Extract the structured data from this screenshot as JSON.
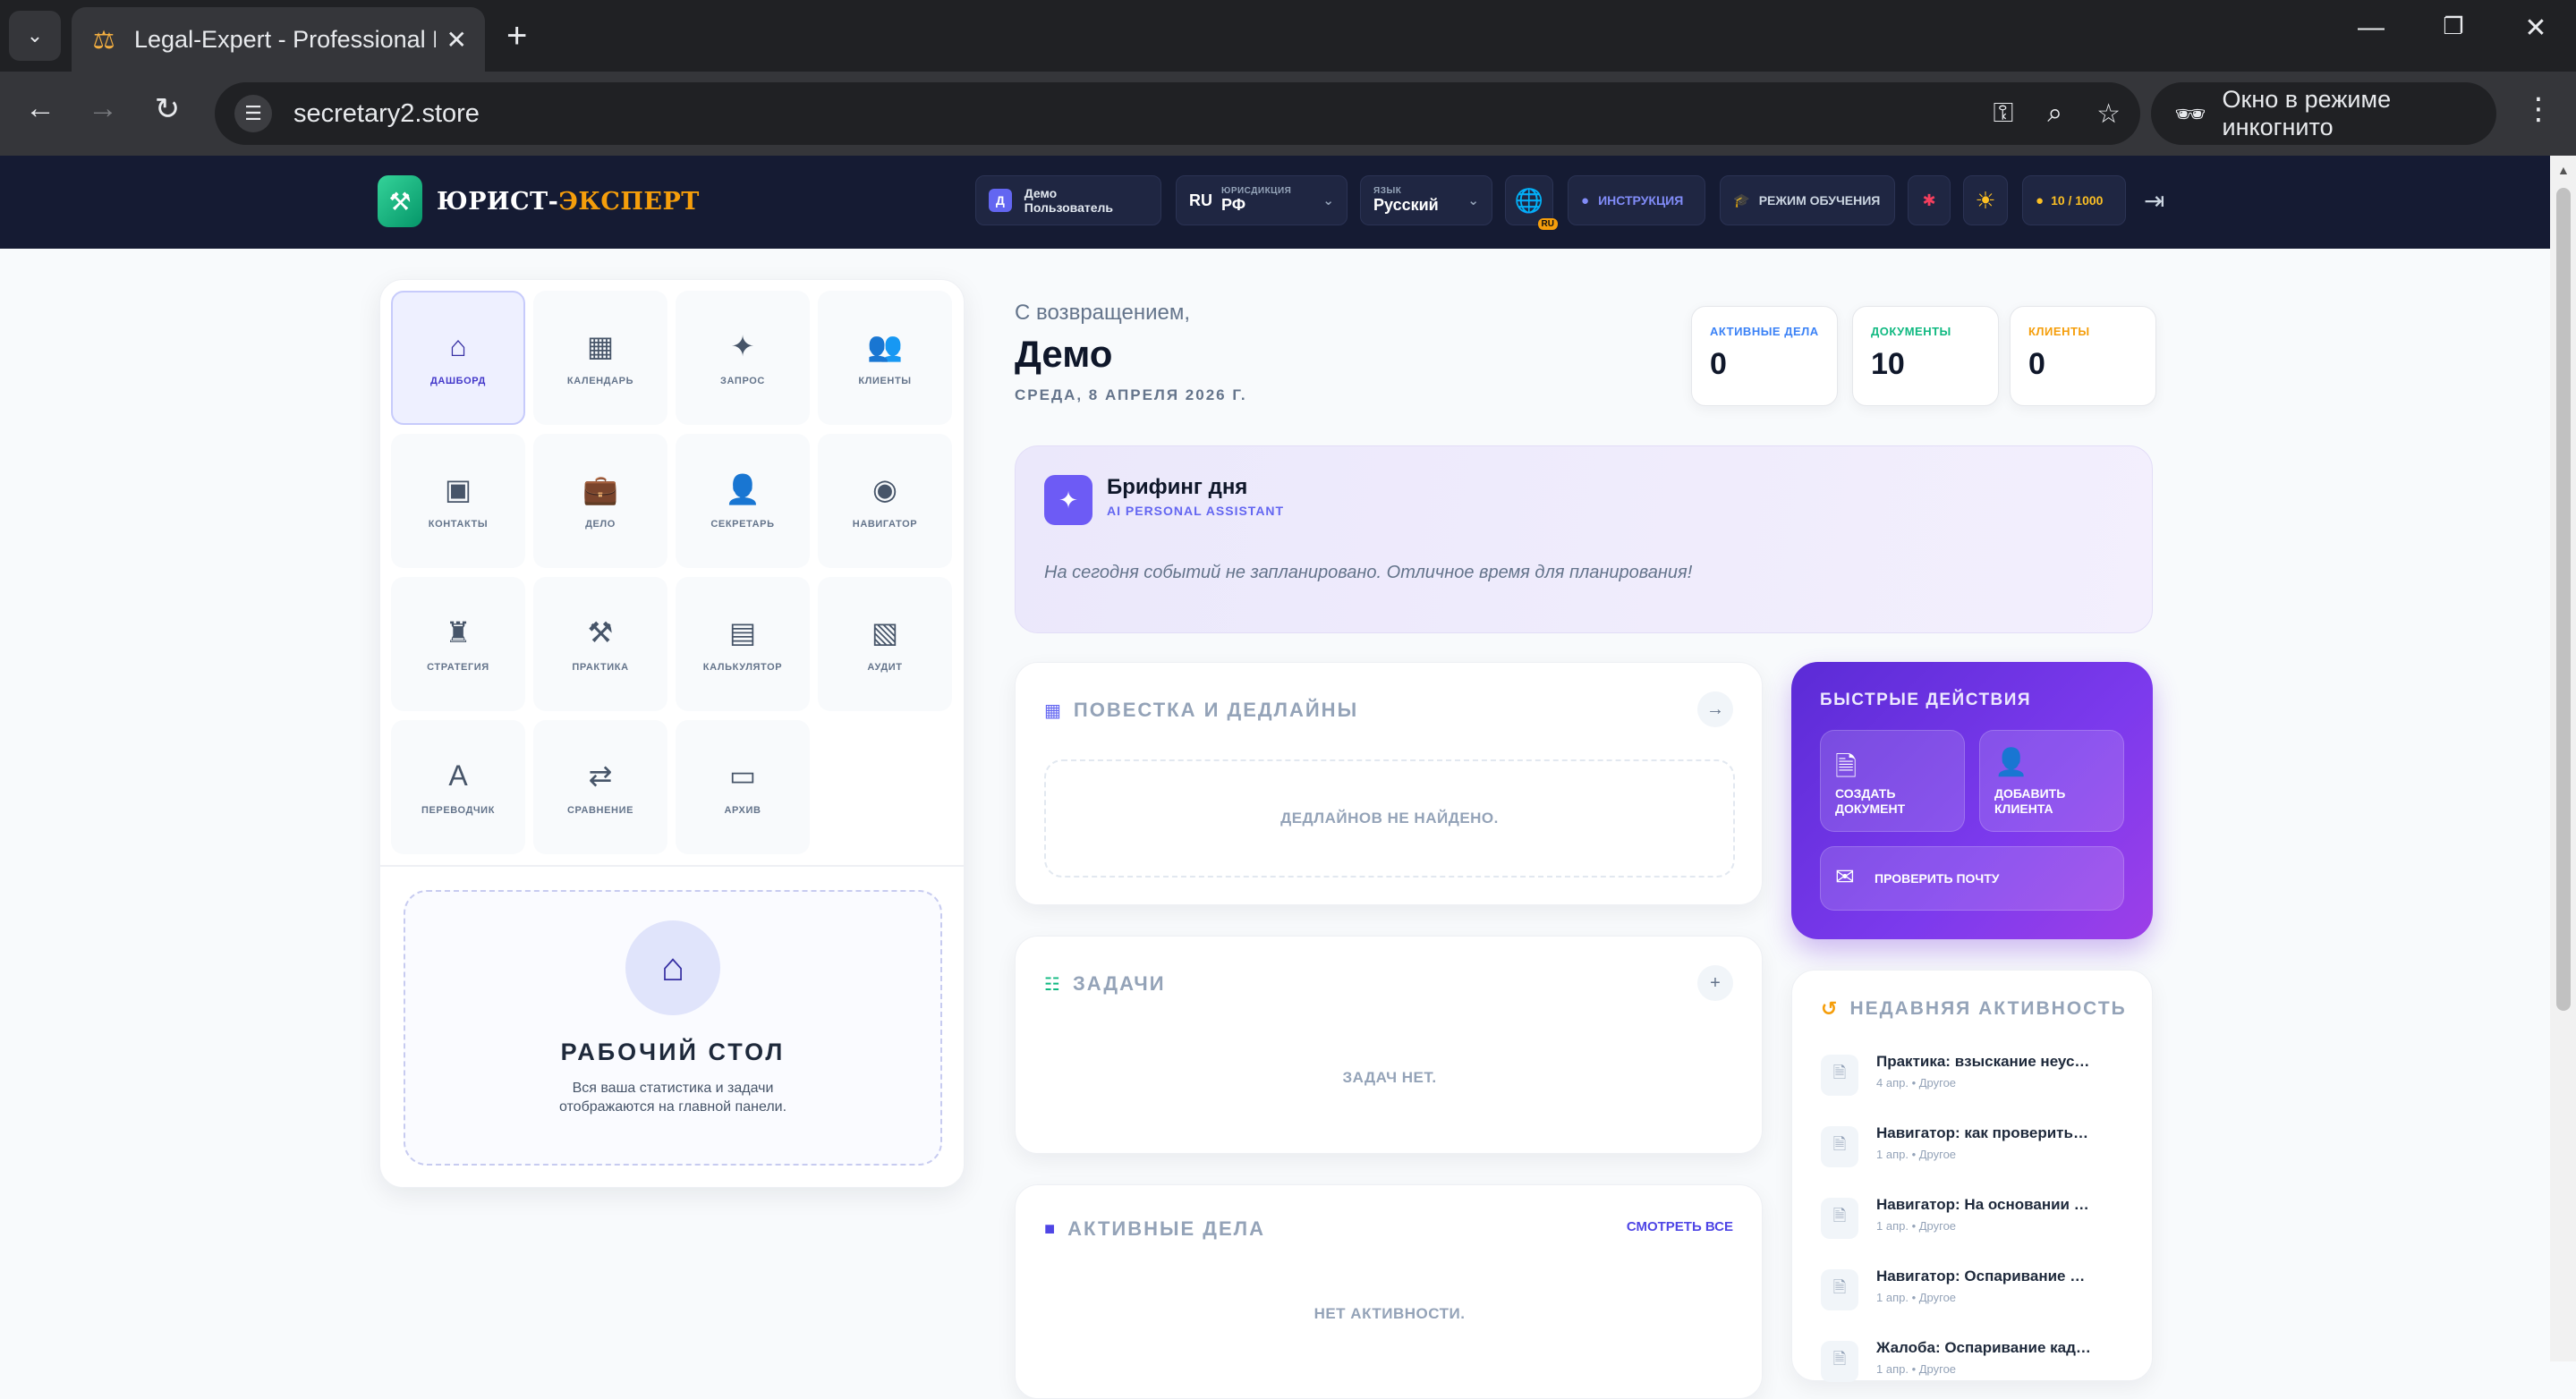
{
  "browser": {
    "tab_title": "Legal-Expert - Professional Legal",
    "url": "secretary2.store",
    "incognito_label": "Окно в режиме инкогнито"
  },
  "header": {
    "logo_part1": "ЮРИСТ-",
    "logo_part2": "ЭКСПЕРТ",
    "user_initial": "Д",
    "user_name": "Демо Пользователь",
    "jurisdiction_code": "RU",
    "jurisdiction_label": "ЮРИСДИКЦИЯ",
    "jurisdiction_value": "РФ",
    "language_label": "ЯЗЫК",
    "language_value": "Русский",
    "globe_badge": "RU",
    "instruction_label": "ИНСТРУКЦИЯ",
    "training_label": "РЕЖИМ ОБУЧЕНИЯ",
    "credits": "10 / 1000"
  },
  "sidebar": {
    "modules": [
      {
        "label": "ДАШБОРД",
        "icon": "home-icon",
        "glyph": "⌂",
        "active": true
      },
      {
        "label": "КАЛЕНДАРЬ",
        "icon": "calendar-icon",
        "glyph": "▦"
      },
      {
        "label": "ЗАПРОС",
        "icon": "magic-wand-icon",
        "glyph": "✦"
      },
      {
        "label": "КЛИЕНТЫ",
        "icon": "users-icon",
        "glyph": "👥"
      },
      {
        "label": "КОНТАКТЫ",
        "icon": "contact-card-icon",
        "glyph": "▣"
      },
      {
        "label": "ДЕЛО",
        "icon": "briefcase-icon",
        "glyph": "💼"
      },
      {
        "label": "СЕКРЕТАРЬ",
        "icon": "secretary-icon",
        "glyph": "👤"
      },
      {
        "label": "НАВИГАТОР",
        "icon": "compass-icon",
        "glyph": "◉"
      },
      {
        "label": "СТРАТЕГИЯ",
        "icon": "chess-icon",
        "glyph": "♜"
      },
      {
        "label": "ПРАКТИКА",
        "icon": "gavel-icon",
        "glyph": "⚒"
      },
      {
        "label": "КАЛЬКУЛЯТОР",
        "icon": "calculator-icon",
        "glyph": "▤"
      },
      {
        "label": "АУДИТ",
        "icon": "file-shield-icon",
        "glyph": "▧"
      },
      {
        "label": "ПЕРЕВОДЧИК",
        "icon": "translate-icon",
        "glyph": "A"
      },
      {
        "label": "СРАВНЕНИЕ",
        "icon": "compare-icon",
        "glyph": "⇄"
      },
      {
        "label": "АРХИВ",
        "icon": "archive-icon",
        "glyph": "▭"
      }
    ],
    "desk_title": "РАБОЧИЙ СТОЛ",
    "desk_text": "Вся ваша статистика и задачи отображаются на главной панели."
  },
  "main": {
    "welcome": "С возвращением,",
    "user": "Демо",
    "date": "СРЕДА, 8 АПРЕЛЯ 2026 Г.",
    "stats": [
      {
        "label": "АКТИВНЫЕ ДЕЛА",
        "value": "0",
        "color": "#3b82f6"
      },
      {
        "label": "ДОКУМЕНТЫ",
        "value": "10",
        "color": "#10b981"
      },
      {
        "label": "КЛИЕНТЫ",
        "value": "0",
        "color": "#f59e0b"
      }
    ],
    "briefing": {
      "title": "Брифинг дня",
      "subtitle": "AI PERSONAL ASSISTANT",
      "message": "На сегодня событий не запланировано. Отличное время для планирования!"
    },
    "agenda": {
      "title": "ПОВЕСТКА И ДЕДЛАЙНЫ",
      "empty": "ДЕДЛАЙНОВ НЕ НАЙДЕНО."
    },
    "tasks": {
      "title": "ЗАДАЧИ",
      "empty": "ЗАДАЧ НЕТ."
    },
    "cases": {
      "title": "АКТИВНЫЕ ДЕЛА",
      "link": "СМОТРЕТЬ ВСЕ",
      "empty": "НЕТ АКТИВНОСТИ."
    },
    "quick": {
      "title": "БЫСТРЫЕ ДЕЙСТВИЯ",
      "create_doc_1": "СОЗДАТЬ",
      "create_doc_2": "ДОКУМЕНТ",
      "add_client_1": "ДОБАВИТЬ",
      "add_client_2": "КЛИЕНТА",
      "check_mail": "ПРОВЕРИТЬ ПОЧТУ"
    },
    "activity": {
      "title": "НЕДАВНЯЯ АКТИВНОСТЬ",
      "items": [
        {
          "name": "Практика: взыскание неустойки",
          "meta": "4 апр. • Другое"
        },
        {
          "name": "Навигатор: как проверить контрагента",
          "meta": "1 апр. • Другое"
        },
        {
          "name": "Навигатор: На основании какого закона",
          "meta": "1 апр. • Другое"
        },
        {
          "name": "Навигатор: Оспаривание кадастровой",
          "meta": "1 апр. • Другое"
        },
        {
          "name": "Жалоба: Оспаривание кадастровой",
          "meta": "1 апр. • Другое"
        }
      ]
    }
  }
}
